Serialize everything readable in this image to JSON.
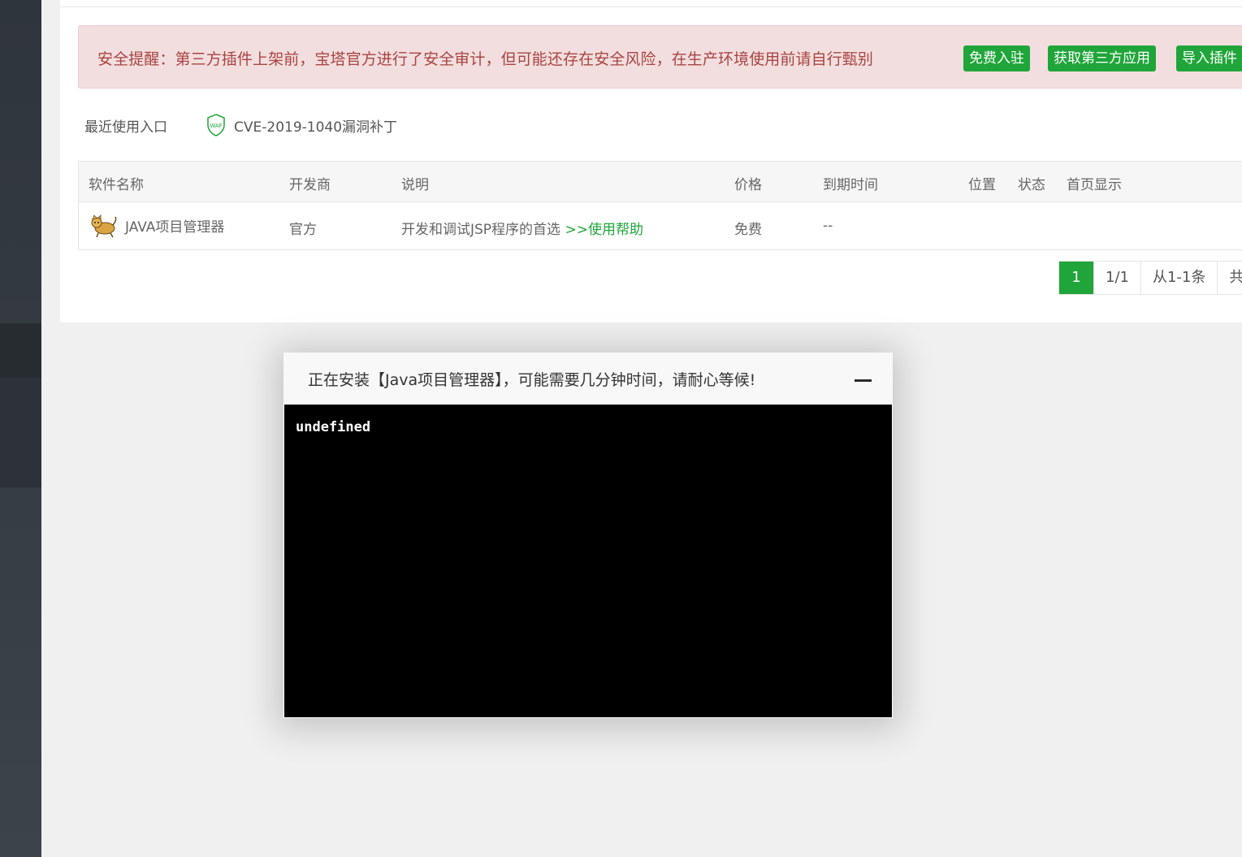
{
  "alert": {
    "text": "安全提醒：第三方插件上架前，宝塔官方进行了安全审计，但可能还存在安全风险，在生产环境使用前请自行甄别",
    "buttons": [
      "免费入驻",
      "获取第三方应用",
      "导入插件"
    ]
  },
  "recent": {
    "label": "最近使用入口",
    "items": [
      {
        "icon": "waf-shield-icon",
        "icon_text": "WAF",
        "label": "CVE-2019-1040漏洞补丁"
      }
    ]
  },
  "table": {
    "headers": [
      "软件名称",
      "开发商",
      "说明",
      "价格",
      "到期时间",
      "位置",
      "状态",
      "首页显示"
    ],
    "rows": [
      {
        "icon": "tomcat-icon",
        "name": "JAVA项目管理器",
        "developer": "官方",
        "description": "开发和调试JSP程序的首选",
        "help_link": ">>使用帮助",
        "price": "免费",
        "expiry": "--"
      }
    ]
  },
  "pager": {
    "current": "1",
    "pages": "1/1",
    "range": "从1-1条",
    "total_partial": "共"
  },
  "modal": {
    "title": "正在安装【Java项目管理器】，可能需要几分钟时间，请耐心等候!",
    "terminal_output": "undefined"
  },
  "colors": {
    "accent": "#20a53a",
    "alert_bg": "#f2dede",
    "alert_text": "#a94442",
    "sidebar": "#343a41",
    "terminal_bg": "#000000"
  }
}
